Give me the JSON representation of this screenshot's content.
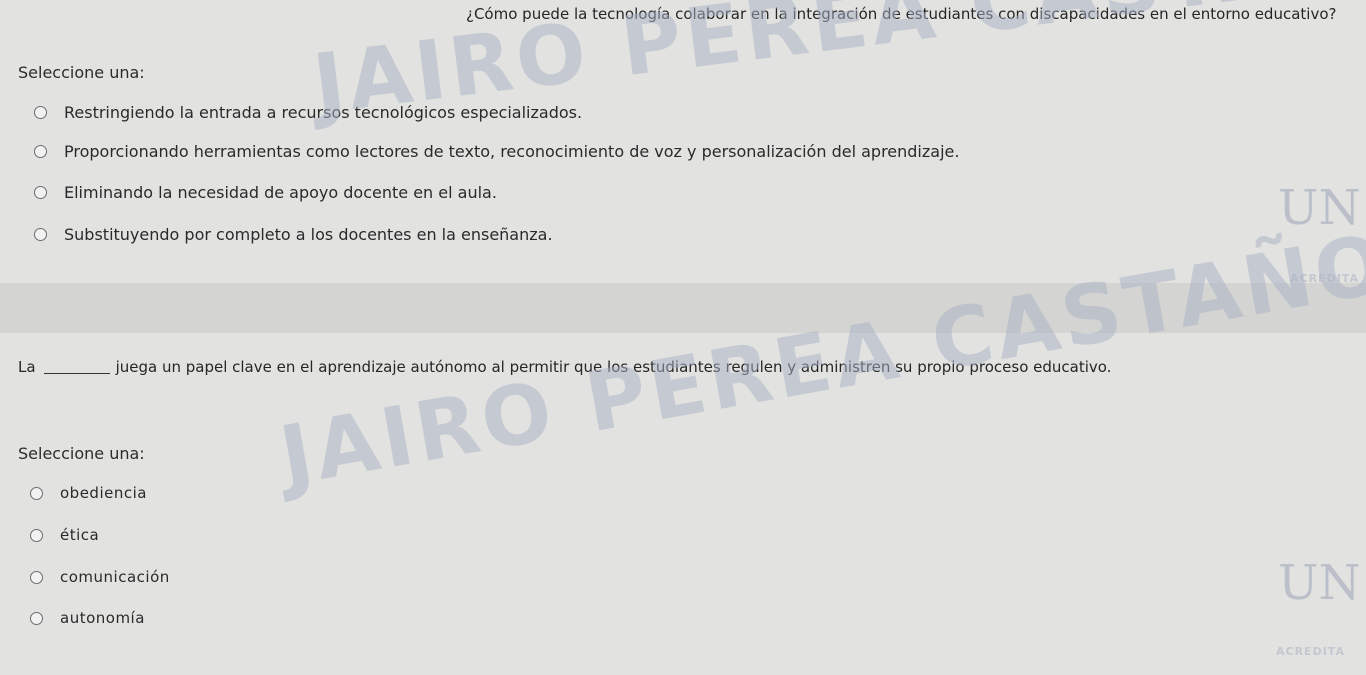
{
  "question1": {
    "text": "¿Cómo puede la tecnología colaborar en la integración de estudiantes con discapacidades en el entorno educativo?",
    "select_label": "Seleccione una:",
    "options": [
      "Restringiendo la entrada a recursos tecnológicos especializados.",
      "Proporcionando herramientas como lectores de texto, reconocimiento de voz y personalización del aprendizaje.",
      "Eliminando la necesidad de apoyo docente en el aula.",
      "Substituyendo por completo a los docentes en la enseñanza."
    ]
  },
  "question2": {
    "text_before": "La",
    "text_after": "juega un papel clave en el aprendizaje autónomo al permitir que los estudiantes regulen y administren su propio proceso educativo.",
    "select_label": "Seleccione una:",
    "options": [
      "obediencia",
      "ética",
      "comunicación",
      "autonomía"
    ]
  },
  "watermark": {
    "text": "JAIRO PEREA CASTAÑO",
    "logo": "UN",
    "accreditation": "ACREDITA"
  },
  "icons": [
    "radio-unselected-icon",
    "university-logo-icon"
  ]
}
